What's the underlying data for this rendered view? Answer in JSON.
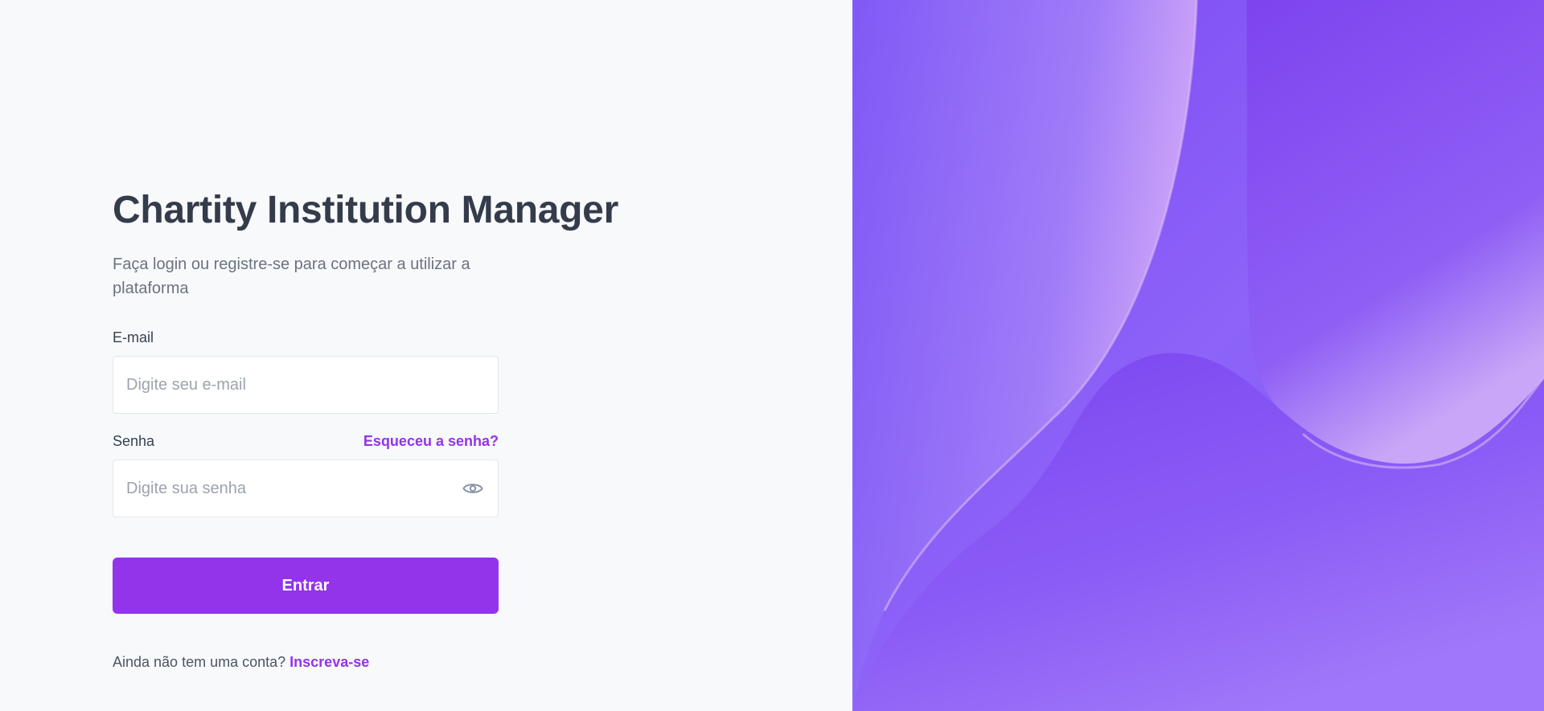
{
  "title": "Chartity Institution Manager",
  "subtitle": "Faça login ou registre-se para começar a utilizar a plataforma",
  "email": {
    "label": "E-mail",
    "placeholder": "Digite seu e-mail",
    "value": ""
  },
  "password": {
    "label": "Senha",
    "placeholder": "Digite sua senha",
    "value": "",
    "forgot_link": "Esqueceu a senha?",
    "toggle_icon": "eye-icon"
  },
  "submit_label": "Entrar",
  "signup": {
    "prompt": "Ainda não tem uma conta?",
    "link": "Inscreva-se"
  },
  "colors": {
    "accent": "#9333ea",
    "title": "#343c4b",
    "background": "#f8f9fb",
    "art_primary": "#7c4dfa",
    "art_light": "#c69af7"
  }
}
